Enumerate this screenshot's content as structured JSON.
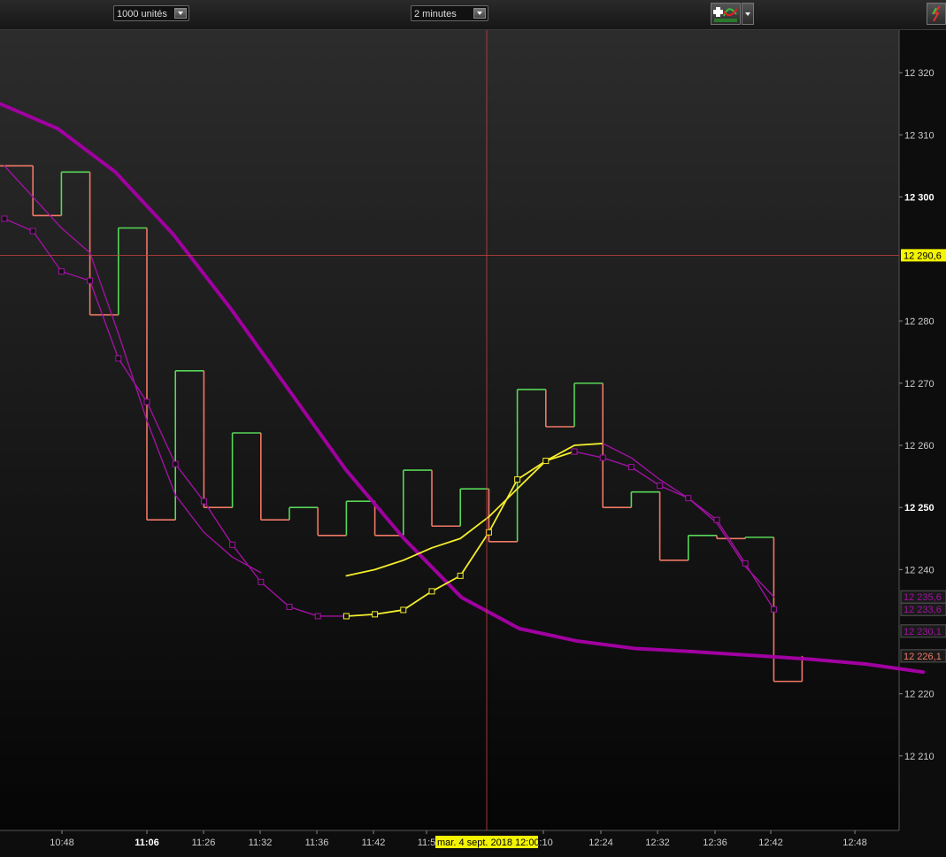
{
  "toolbar": {
    "units_select": "1000 unités",
    "period_select": "2 minutes"
  },
  "icons": {
    "indicator_tool": "add-indicator-icon",
    "corner_tool": "refresh-arrows-icon"
  },
  "colors": {
    "background_top": "#2c2c2c",
    "background_bottom": "#050505",
    "up": "#57d657",
    "down": "#ef7866",
    "ma_thick": "#a000a0",
    "ma_thin": "#a012a0",
    "yellow": "#f4ee2c",
    "crosshair": "#c84040"
  },
  "crosshair": {
    "price_label": "12 290,6",
    "date_label": "mar. 4 sept. 2018 12:00",
    "price_value": 12290.6
  },
  "chart_data": {
    "type": "line",
    "title": "",
    "ylim": [
      12198,
      12327
    ],
    "y_ticks": [
      {
        "value": 12320,
        "label": "12 320",
        "bold": false
      },
      {
        "value": 12310,
        "label": "12 310",
        "bold": false
      },
      {
        "value": 12300,
        "label": "12 300",
        "bold": true
      },
      {
        "value": 12280,
        "label": "12 280",
        "bold": false
      },
      {
        "value": 12270,
        "label": "12 270",
        "bold": false
      },
      {
        "value": 12260,
        "label": "12 260",
        "bold": false
      },
      {
        "value": 12250,
        "label": "12 250",
        "bold": true
      },
      {
        "value": 12240,
        "label": "12 240",
        "bold": false
      },
      {
        "value": 12220,
        "label": "12 220",
        "bold": false
      },
      {
        "value": 12210,
        "label": "12 210",
        "bold": false
      }
    ],
    "x_ticks": [
      {
        "label": "10:48",
        "bold": false
      },
      {
        "label": "11:06",
        "bold": true
      },
      {
        "label": "11:26",
        "bold": false
      },
      {
        "label": "11:32",
        "bold": false
      },
      {
        "label": "11:36",
        "bold": false
      },
      {
        "label": "11:42",
        "bold": false
      },
      {
        "label": "11:5",
        "bold": false
      },
      {
        "label": "2:10",
        "bold": false
      },
      {
        "label": "12:24",
        "bold": false
      },
      {
        "label": "12:32",
        "bold": false
      },
      {
        "label": "12:36",
        "bold": false
      },
      {
        "label": "12:42",
        "bold": false
      },
      {
        "label": "12:48",
        "bold": false
      }
    ],
    "price_step": {
      "levels": [
        12305,
        12297,
        12304,
        12281,
        12295,
        12248,
        12272,
        12250,
        12262,
        12248,
        12250,
        12245.5,
        12251,
        12245.5,
        12256,
        12247,
        12253,
        12244.5,
        12269,
        12263,
        12270,
        12250,
        12252.5,
        12241.5,
        12245.5,
        12245,
        12245.2,
        12222
      ],
      "directions": [
        "down",
        "down",
        "up",
        "down",
        "up",
        "down",
        "up",
        "down",
        "up",
        "down",
        "up",
        "down",
        "up",
        "down",
        "up",
        "down",
        "up",
        "down",
        "up",
        "down",
        "up",
        "down",
        "up",
        "down",
        "up",
        "down",
        "up",
        "down"
      ],
      "last": 12226.1
    },
    "series": [
      {
        "name": "",
        "values": [
          12315,
          12311,
          12304,
          12294,
          12282,
          12269,
          12256,
          12245,
          12235.5,
          12230.5,
          12228.5,
          12227.3,
          12226.8,
          12226.2,
          12225.6,
          12224.8,
          12223.5
        ],
        "last_label": "12 230,1"
      },
      {
        "name": "",
        "values": [
          12305,
          12300,
          12295,
          12291,
          12278,
          12264,
          12252,
          12246,
          12242,
          12239.5,
          null,
          null,
          null,
          null,
          null,
          null,
          null,
          null,
          null,
          null,
          null,
          null,
          null,
          null,
          null,
          null,
          null,
          null,
          null,
          null
        ],
        "last_label": "12 235,6"
      },
      {
        "name": "",
        "values": [
          12296.5,
          12294.5,
          12288,
          12286.5,
          12274,
          12267,
          12257,
          12251,
          12244,
          12238,
          12234,
          12232.5,
          12232.5,
          null,
          null,
          null,
          null,
          null,
          null,
          null,
          null,
          null,
          null,
          null,
          null,
          null,
          null,
          null,
          null,
          null
        ],
        "last_label": "12 233,6"
      },
      {
        "name": "",
        "values": [
          null,
          null,
          null,
          null,
          null,
          null,
          null,
          null,
          null,
          null,
          null,
          null,
          12239,
          12240,
          12241.5,
          12243.5,
          12245,
          12248.5,
          12253,
          12257.5,
          12260,
          12260.3,
          null,
          null,
          null,
          null,
          null,
          null,
          null,
          null
        ]
      },
      {
        "name": "",
        "values": [
          null,
          null,
          null,
          null,
          null,
          null,
          null,
          null,
          null,
          null,
          null,
          null,
          12232.5,
          12232.8,
          12233.5,
          12236.5,
          12239,
          12246,
          12254.5,
          12257.5,
          12259,
          null,
          null,
          null,
          null,
          null,
          null,
          null,
          null,
          null
        ]
      },
      {
        "name": "",
        "values": [
          null,
          null,
          null,
          null,
          null,
          null,
          null,
          null,
          null,
          null,
          null,
          null,
          null,
          null,
          null,
          null,
          null,
          null,
          null,
          null,
          null,
          12260.3,
          12258,
          12254.5,
          12251.5,
          12247.5,
          12240.5,
          12235.6
        ]
      },
      {
        "name": "",
        "values": [
          null,
          null,
          null,
          null,
          null,
          null,
          null,
          null,
          null,
          null,
          null,
          null,
          null,
          null,
          null,
          null,
          null,
          null,
          null,
          null,
          12259,
          12258,
          12256.5,
          12253.5,
          12251.5,
          12248,
          12241,
          12233.6
        ]
      }
    ]
  }
}
